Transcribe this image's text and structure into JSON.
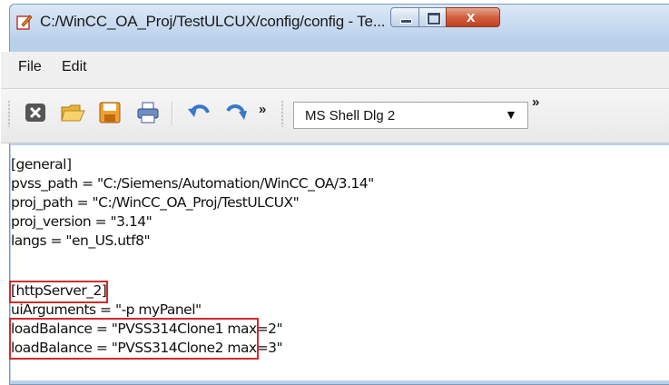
{
  "window": {
    "title": "C:/WinCC_OA_Proj/TestULCUX/config/config - Te...",
    "close_glyph": "x"
  },
  "menu": [
    "File",
    "Edit"
  ],
  "toolbar": {
    "icons": [
      "close-doc-icon",
      "open-folder-icon",
      "save-icon",
      "print-icon",
      "undo-icon",
      "redo-icon"
    ],
    "overflow_glyph": "»",
    "font_select_value": "MS Shell Dlg 2",
    "dropdown_glyph": "▼"
  },
  "editor": {
    "lines": [
      "[general]",
      "pvss_path = \"C:/Siemens/Automation/WinCC_OA/3.14\"",
      "proj_path = \"C:/WinCC_OA_Proj/TestULCUX\"",
      "proj_version = \"3.14\"",
      "langs = \"en_US.utf8\"",
      "",
      "[httpServer_2]",
      "uiArguments = \"-p myPanel\"",
      "loadBalance = \"PVSS314Clone1 max=2\"",
      "loadBalance = \"PVSS314Clone2 max=3\""
    ]
  },
  "colors": {
    "highlight_box": "#d42b2b",
    "title_bar": "#bcd2ec",
    "close_button": "#c24023"
  }
}
